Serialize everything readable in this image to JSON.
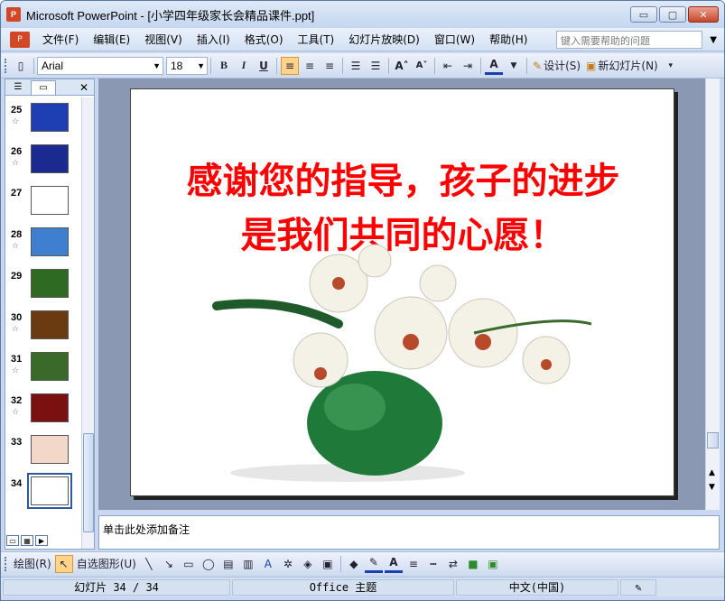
{
  "window": {
    "title": "Microsoft PowerPoint - [小学四年级家长会精品课件.ppt]",
    "app_icon": "P"
  },
  "window_controls": {
    "minimize": "▭",
    "maximize": "▢",
    "close": "✕"
  },
  "menubar": {
    "items": [
      "文件(F)",
      "编辑(E)",
      "视图(V)",
      "插入(I)",
      "格式(O)",
      "工具(T)",
      "幻灯片放映(D)",
      "窗口(W)",
      "帮助(H)"
    ],
    "help_placeholder": "键入需要帮助的问题"
  },
  "formatting": {
    "font_name": "Arial",
    "font_size": "18",
    "bold": "B",
    "italic": "I",
    "underline": "U",
    "design_label": "设计(S)",
    "new_slide_label": "新幻灯片(N)"
  },
  "slides": [
    {
      "num": "25",
      "star": "☆",
      "color": "#1d3fb3"
    },
    {
      "num": "26",
      "star": "☆",
      "color": "#1a2a90"
    },
    {
      "num": "27",
      "star": "",
      "color": "#2a5bd7"
    },
    {
      "num": "28",
      "star": "☆",
      "color": "#3e7fd0"
    },
    {
      "num": "29",
      "star": "",
      "color": "#2e6a22"
    },
    {
      "num": "30",
      "star": "☆",
      "color": "#6a3a10"
    },
    {
      "num": "31",
      "star": "☆",
      "color": "#3a6a2a"
    },
    {
      "num": "32",
      "star": "☆",
      "color": "#7a1010"
    },
    {
      "num": "33",
      "star": "",
      "color": "#c43c1a"
    },
    {
      "num": "34",
      "star": "",
      "color": "#ffffff"
    }
  ],
  "slide": {
    "line1": "感谢您的指导，孩子的进步",
    "line2": "是我们共同的心愿！",
    "text_color": "#ff0000"
  },
  "notes": {
    "placeholder": "单击此处添加备注"
  },
  "drawing": {
    "draw_label": "绘图(R)",
    "autoshape_label": "自选图形(U)"
  },
  "status": {
    "slide_info": "幻灯片 34 / 34",
    "theme": "Office 主题",
    "language": "中文(中国)"
  }
}
